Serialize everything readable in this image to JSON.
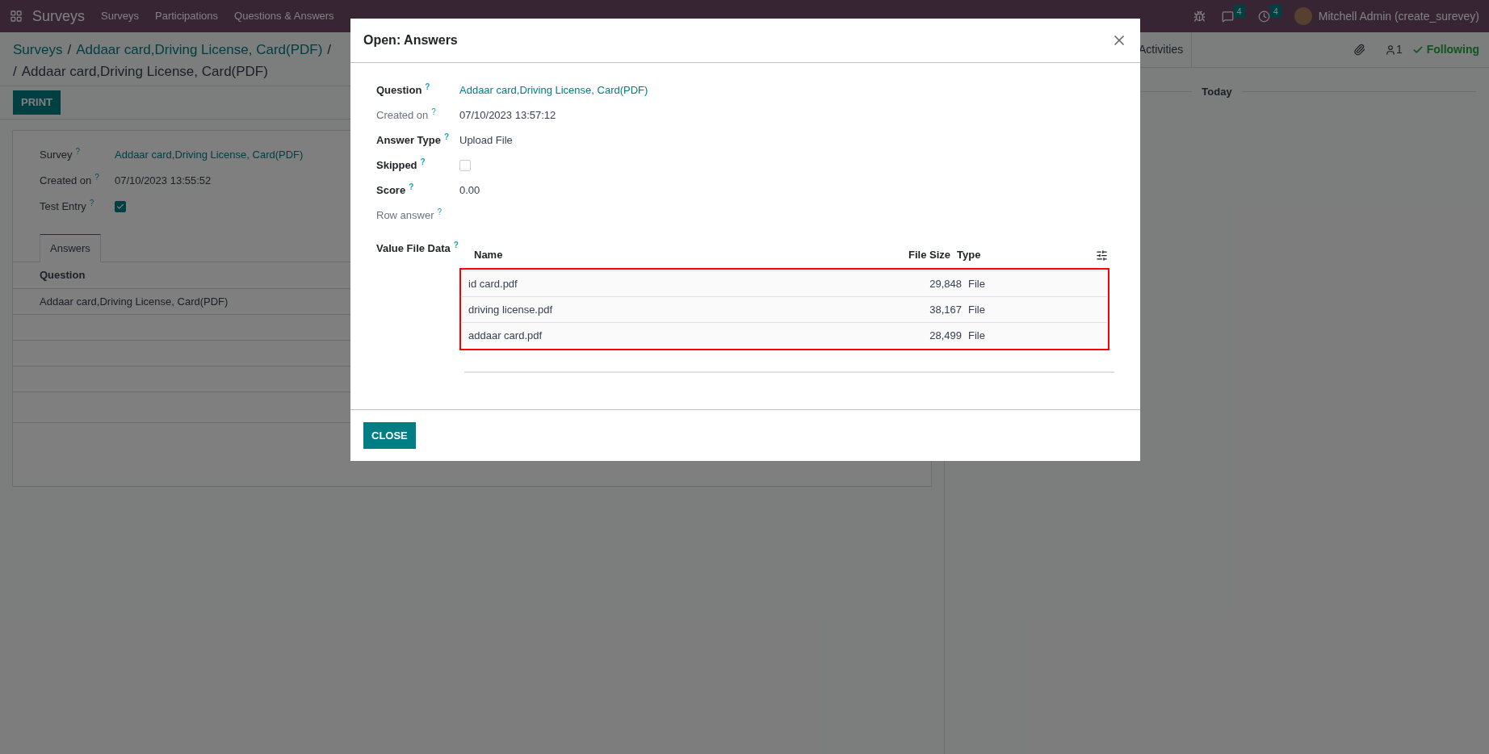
{
  "navbar": {
    "app_name": "Surveys",
    "menu": [
      "Surveys",
      "Participations",
      "Questions & Answers"
    ],
    "messages_count": "4",
    "activities_count": "4",
    "user": "Mitchell Admin (create_surevey)"
  },
  "breadcrumb": {
    "lines": [
      [
        {
          "kind": "link",
          "text": "Surveys"
        },
        {
          "kind": "separator",
          "text": "/"
        },
        {
          "kind": "link",
          "text": "Addaar card,Driving License, Card(PDF)"
        },
        {
          "kind": "separator",
          "text": "/"
        }
      ],
      [
        {
          "kind": "separator",
          "text": "/"
        },
        {
          "kind": "current",
          "text": "Addaar card,Driving License, Card(PDF)"
        }
      ]
    ]
  },
  "print_button": "PRINT",
  "form": {
    "fields": [
      {
        "label": "Survey",
        "help": "?",
        "kind": "link",
        "value": "Addaar card,Driving License, Card(PDF)"
      },
      {
        "label": "Created on",
        "help": "?",
        "kind": "text",
        "value": "07/10/2023 13:55:52"
      },
      {
        "label": "Test Entry",
        "help": "?",
        "kind": "checkbox",
        "checked": true
      }
    ],
    "tabs": [
      {
        "label": "Answers",
        "selected": true
      }
    ],
    "list": {
      "columns": [
        "Question"
      ],
      "rows": [
        [
          "Addaar card,Driving License, Card(PDF)"
        ]
      ]
    }
  },
  "chatter": {
    "activities": "Activities",
    "followers": "1",
    "following": "Following",
    "date_separator": "Today"
  },
  "dialog": {
    "title": "Open: Answers",
    "fields": [
      {
        "label": "Question",
        "help": "?",
        "required": true,
        "kind": "link",
        "value": "Addaar card,Driving License, Card(PDF)"
      },
      {
        "label": "Created on",
        "help": "?",
        "required": false,
        "kind": "text",
        "value": "07/10/2023 13:57:12"
      },
      {
        "label": "Answer Type",
        "help": "?",
        "required": true,
        "kind": "text",
        "value": "Upload File"
      },
      {
        "label": "Skipped",
        "help": "?",
        "required": true,
        "kind": "checkbox",
        "checked": false
      },
      {
        "label": "Score",
        "help": "?",
        "required": true,
        "kind": "text",
        "value": "0.00"
      },
      {
        "label": "Row answer",
        "help": "?",
        "required": false,
        "kind": "empty"
      },
      {
        "label": "Value File Data",
        "help": "?",
        "required": true,
        "kind": "table"
      }
    ],
    "files": {
      "columns": [
        "Name",
        "File Size",
        "Type"
      ],
      "rows": [
        {
          "name": "id card.pdf",
          "size": "29,848",
          "type": "File"
        },
        {
          "name": "driving license.pdf",
          "size": "38,167",
          "type": "File"
        },
        {
          "name": "addaar card.pdf",
          "size": "28,499",
          "type": "File"
        }
      ]
    },
    "close_button": "CLOSE"
  }
}
